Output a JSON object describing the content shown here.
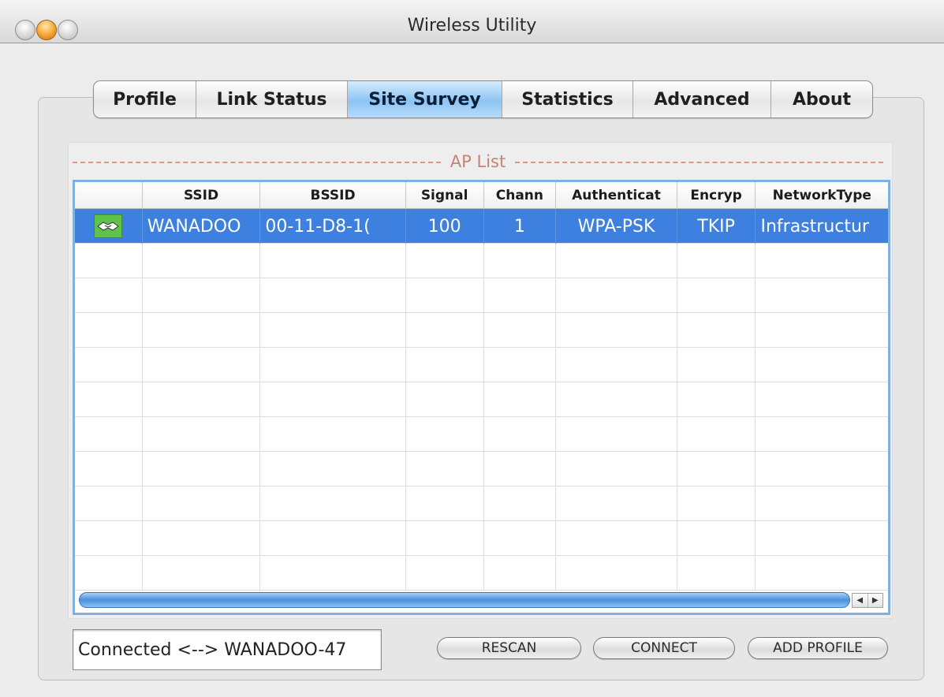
{
  "window": {
    "title": "Wireless Utility"
  },
  "tabs": [
    {
      "label": "Profile",
      "active": false
    },
    {
      "label": "Link Status",
      "active": false
    },
    {
      "label": "Site Survey",
      "active": true
    },
    {
      "label": "Statistics",
      "active": false
    },
    {
      "label": "Advanced",
      "active": false
    },
    {
      "label": "About",
      "active": false
    }
  ],
  "ap_list": {
    "title": "AP List",
    "columns": [
      "",
      "SSID",
      "BSSID",
      "Signal",
      "Chann",
      "Authenticat",
      "Encryp",
      "NetworkType"
    ],
    "rows": [
      {
        "icon": "handshake-icon",
        "ssid": "WANADOO",
        "bssid": "00-11-D8-1(",
        "signal": "100",
        "channel": "1",
        "authentication": "WPA-PSK",
        "encryption": "TKIP",
        "network_type": "Infrastructur",
        "selected": true
      }
    ]
  },
  "status": {
    "text": "Connected <--> WANADOO-47"
  },
  "buttons": {
    "rescan": "RESCAN",
    "connect": "CONNECT",
    "add_profile": "ADD PROFILE"
  },
  "colors": {
    "selection": "#3d80df",
    "active_tab": "#8cc4f4",
    "ap_list_title": "#c4846f"
  }
}
